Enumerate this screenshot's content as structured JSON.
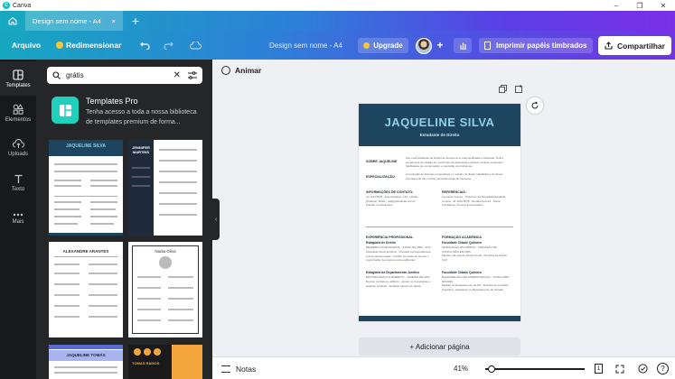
{
  "window": {
    "app_name": "Canva"
  },
  "tabs": [
    {
      "label": "Design sem nome - A4",
      "close": "×"
    }
  ],
  "newtab": "+",
  "toolbar": {
    "file": "Arquivo",
    "resize": "Redimensionar",
    "doc_title": "Design sem nome - A4",
    "upgrade": "Upgrade",
    "add_user": "+",
    "print": "Imprimir papéis timbrados",
    "share": "Compartilhar"
  },
  "rail": [
    {
      "label": "Templates",
      "icon": "templates-icon"
    },
    {
      "label": "Elementos",
      "icon": "elements-icon"
    },
    {
      "label": "Uploads",
      "icon": "upload-icon"
    },
    {
      "label": "Texto",
      "icon": "text-icon"
    },
    {
      "label": "Mais",
      "icon": "more-icon"
    }
  ],
  "search": {
    "query": "grátis"
  },
  "promo": {
    "title": "Templates Pro",
    "desc_line1": "Tenha acesso a toda a nossa biblioteca",
    "desc_line2": "de templates premium de forma..."
  },
  "thumbs": {
    "t1_name": "JAQUELINE SILVA",
    "t2_name": "JENNIFER MARTINS",
    "t3_name": "ALEXANDRE ARANTES",
    "t4_name": "Nadia Oliva",
    "t5_name": "JAQUELINE TOMÁS",
    "t6_name": "TOMAS RAMOS"
  },
  "canvas": {
    "animate": "Animar",
    "add_page": "+ Adicionar página"
  },
  "resume": {
    "name": "JAQUELINE SILVA",
    "role": "Estudante de Direito",
    "about_label": "SOBRE JAQUELINE",
    "about_text": "Sou uma estudante de Direito do terceiro ano muito dedicada e obstinada. Tenho experiência de estágio em escritórios de advocacia e destaco minhas excelentes habilidades de comunicação e resolução de problemas.",
    "spec_label": "ESPECIALIZAÇÃO",
    "spec_text": "A resolução de disputas corporativas e o estudo do direito trabalhista e de direito internacional são minhas principais áreas de interesse.",
    "contact_label": "INFORMAÇÕES DE CONTATO:",
    "contact_text": "11 1234 5678 · Rua Qualquer, 123, Cidade Qualquer, Brasil · ola@grandesite.com.br · linkedin.com/jaqueline",
    "ref_label": "REFERÊNCIAS:",
    "ref_text": "Leonardo Gomes · Professor da Faculdade Estadual Central · 11 1234 5678 · Renata Ferreira · Sócia Fundadora, Ferreira & Associados",
    "exp_label": "EXPERIÊNCIA PROFISSIONAL",
    "exp1_title": "Estagiária de Direito",
    "exp1_org": "BEZERRA & ASSOCIADOS · JUNHO DE 2022 - ATUAL",
    "exp1_text": "Pesquisar casos jurídicos · Preparar correspondência e documentos legais · Auxiliar na coleta de provas e organização de arquivos para audiências",
    "exp2_title": "Estagiária do Departamento Jurídico",
    "exp2_org": "EDITORA PAVLIO & BARRETO · JANEIRO DE 2021 - MAIO DE 2022",
    "exp2_text": "Revisar contratos e aditivos · Apoiar com pesquisas e análises jurídicas · Atualizar bancos de dados",
    "edu_label": "FORMAÇÃO ACADÊMICA",
    "edu1_title": "Faculdade Cidade Quimera",
    "edu1_org": "GRADUAÇÃO EM DIREITO · PREVISÃO DE CONCLUSÃO EM 2025",
    "edu1_text": "Membro da Liga de Direito Penal · Monitora de Direito Civil",
    "edu2_title": "Faculdade Cidade Quimera",
    "edu2_org": "BACHARELADO EM ADMINISTRAÇÃO · CONCLUÍDO EM 2020",
    "edu2_text": "Estágio no Departamento de RH · Bolsista de Iniciação Científica · Assistente no Departamento de Vendas"
  },
  "bottom": {
    "notes": "Notas",
    "zoom": "41%",
    "page_count": "1",
    "help": "?"
  },
  "colors": {
    "resume_header": "#1d4560",
    "resume_name": "#8fd0e8",
    "promo": "#1fd1bd",
    "crown": "#ffc431"
  }
}
